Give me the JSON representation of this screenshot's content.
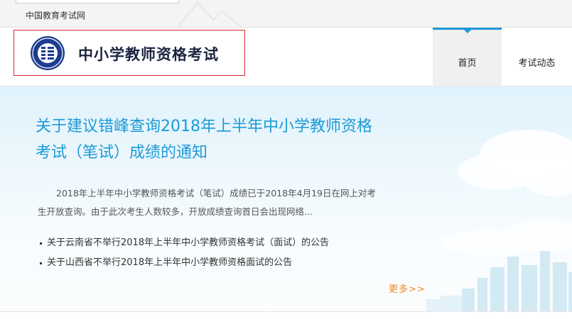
{
  "topbar": {
    "site_link": "中国教育考试网"
  },
  "header": {
    "title": "中小学教师资格考试",
    "nav": [
      {
        "label": "首页",
        "active": true
      },
      {
        "label": "考试动态",
        "active": false
      }
    ]
  },
  "banner": {
    "headline_line1": "关于建议错峰查询2018年上半年中小学教师资格",
    "headline_line2": "考试（笔试）成绩的通知",
    "summary_line1": "2018年上半年中小学教师资格考试（笔试）成绩已于2018年4月19日在网上对考",
    "summary_line2": "生开放查询。由于此次考生人数较多，开放成绩查询首日会出现网络...",
    "news": [
      {
        "title": "关于云南省不举行2018年上半年中小学教师资格考试（面试）的公告"
      },
      {
        "title": "关于山西省不举行2018年上半年中小学教师资格面试的公告"
      }
    ],
    "more_label": "更多>>"
  },
  "colors": {
    "accent_blue": "#1c9ad6",
    "more_orange": "#f08a24",
    "logo_border": "#d9252b",
    "title_navy": "#1b2340"
  },
  "icons": {
    "logo": "teacher-certificate-emblem-icon"
  }
}
